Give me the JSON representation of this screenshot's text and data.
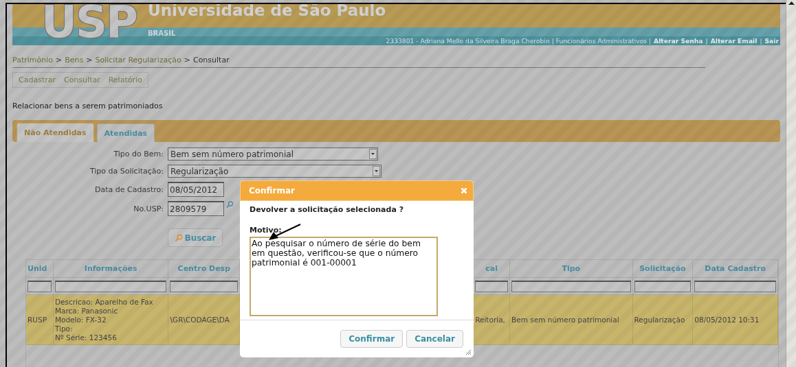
{
  "header": {
    "logo": "USP",
    "title": "Universidade de São Paulo",
    "subtitle": "BRASIL",
    "user_line": [
      {
        "kind": "text",
        "text": "2333801 - Adriana Mello da Silveira Braga Cherobin | Funcionários Administrativos |"
      },
      {
        "kind": "link",
        "text": "Alterar Senha"
      },
      {
        "kind": "text",
        "text": "|"
      },
      {
        "kind": "link",
        "text": "Alterar Email"
      },
      {
        "kind": "text",
        "text": "|"
      },
      {
        "kind": "link",
        "text": "Sair"
      }
    ]
  },
  "breadcrumb": [
    {
      "kind": "link",
      "text": "Patrimônio"
    },
    {
      "kind": "text",
      "text": ">"
    },
    {
      "kind": "link",
      "text": "Bens"
    },
    {
      "kind": "text",
      "text": ">"
    },
    {
      "kind": "link",
      "text": "Solicitar Regularização"
    },
    {
      "kind": "text",
      "text": ">"
    },
    {
      "kind": "text",
      "text": "Consultar"
    }
  ],
  "menu": [
    "Cadastrar",
    "Consultar",
    "Relatório"
  ],
  "page_title": "Relacionar bens a serem patrimoniados",
  "tabs": [
    {
      "label": "Não Atendidas",
      "selected": true
    },
    {
      "label": "Atendidas",
      "selected": false
    }
  ],
  "form": [
    {
      "kind": "select",
      "label": "Tipo do Bem:",
      "value": "Bem sem número patrimonial"
    },
    {
      "kind": "select",
      "label": "Tipo da Solicitação:",
      "value": "Regularização"
    },
    {
      "kind": "input",
      "label": "Data de Cadastro:",
      "value": "08/05/2012"
    },
    {
      "kind": "lookup",
      "label": "No.USP:",
      "value": "2809579"
    }
  ],
  "search_button": "Buscar",
  "table": {
    "columns": [
      "Unid",
      "Informações",
      "Centro Desp",
      "cal",
      "Tipo",
      "Solicitação",
      "Data Cadastro"
    ],
    "rows": [
      {
        "selected": true,
        "cells": [
          "RUSP",
          "Descricao: Aparelho de Fax\nMarca: Panasonic\nModelo: FX-32\nTipo:\nNº Série: 123456",
          "\\GR\\CODAGE\\DA",
          "Reitoria,",
          "Bem sem número patrimonial",
          "Regularização",
          "08/05/2012 10:31"
        ]
      }
    ]
  },
  "dialog": {
    "title": "Confirmar",
    "question": "Devolver a solicitação selecionada ?",
    "field_label": "Motivo:",
    "value": "Ao pesquisar o número de série do bem em questão, verificou-se que o número patrimonial é 001-00001",
    "buttons": [
      "Confirmar",
      "Cancelar"
    ]
  }
}
